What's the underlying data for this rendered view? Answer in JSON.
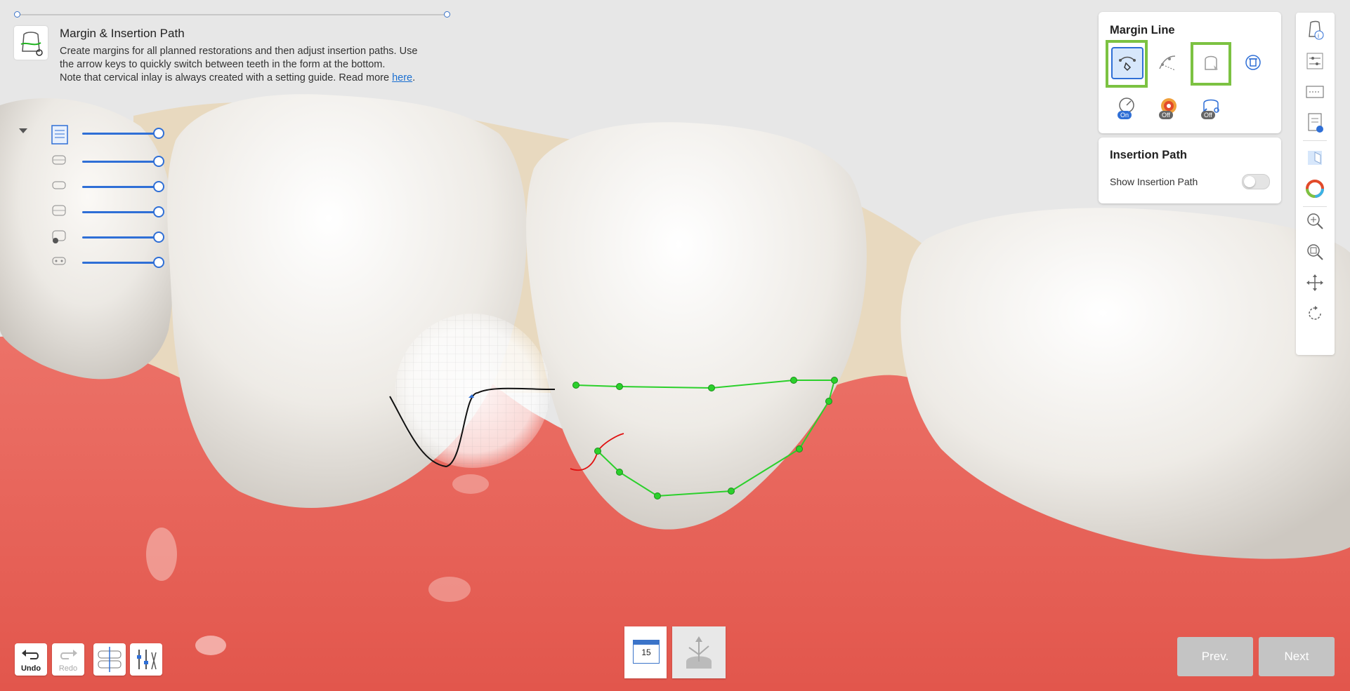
{
  "step": {
    "title": "Margin & Insertion Path",
    "desc_line1": "Create margins for all planned restorations and then adjust insertion paths. Use",
    "desc_line2": "the arrow keys to quickly switch between teeth in the form at the bottom.",
    "desc_line3": "Note that cervical inlay is always created with a setting guide. Read more ",
    "link": "here",
    "period": "."
  },
  "layers": [
    {
      "icon": "document-icon",
      "opacity": 1.0
    },
    {
      "icon": "upper-jaw-icon",
      "opacity": 1.0
    },
    {
      "icon": "lower-jaw-icon",
      "opacity": 1.0
    },
    {
      "icon": "pre-op-icon",
      "opacity": 1.0
    },
    {
      "icon": "scan-data-icon",
      "opacity": 1.0
    },
    {
      "icon": "bite-icon",
      "opacity": 1.0
    }
  ],
  "margin_panel": {
    "title": "Margin Line",
    "tools": [
      "draw-margin-icon",
      "edit-margin-icon",
      "auto-detect-icon",
      "delete-margin-icon"
    ],
    "toggles": [
      {
        "icon": "curvature-icon",
        "state": "On"
      },
      {
        "icon": "color-map-icon",
        "state": "Off"
      },
      {
        "icon": "auto-adjust-icon",
        "state": "Off"
      }
    ]
  },
  "insertion_panel": {
    "title": "Insertion Path",
    "show_label": "Show Insertion Path",
    "show_on": false
  },
  "bottom": {
    "undo": "Undo",
    "redo": "Redo",
    "tooth_number": "15",
    "prev": "Prev.",
    "next": "Next"
  },
  "colors": {
    "accent": "#2f6fd6",
    "highlight": "#7cc242",
    "margin_line": "#2bd02b",
    "gum": "#e8675c"
  }
}
